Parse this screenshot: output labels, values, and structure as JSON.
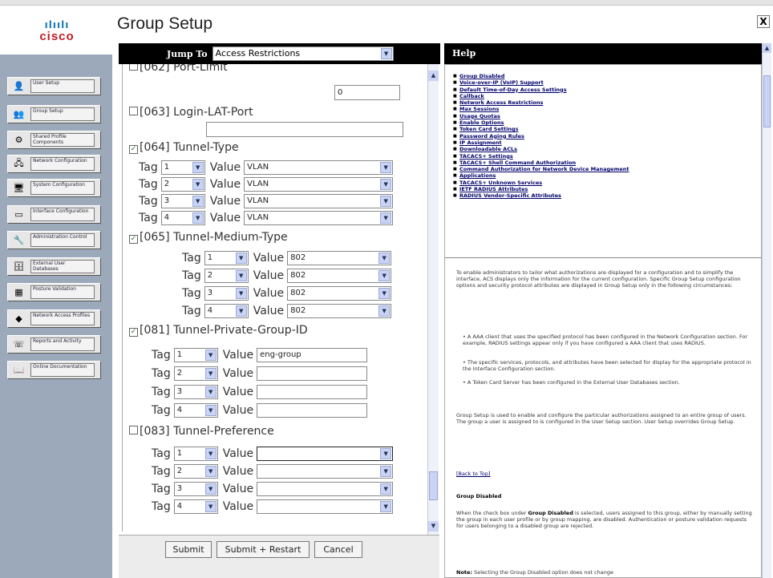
{
  "page": {
    "title": "Group Setup",
    "close": "X"
  },
  "logo": {
    "text": "cisco"
  },
  "nav": [
    {
      "label": "User Setup",
      "icon": "user-icon"
    },
    {
      "label": "Group Setup",
      "icon": "group-icon"
    },
    {
      "label": "Shared Profile Components",
      "icon": "shared-profile-icon"
    },
    {
      "label": "Network Configuration",
      "icon": "network-icon"
    },
    {
      "label": "System Configuration",
      "icon": "system-icon"
    },
    {
      "label": "Interface Configuration",
      "icon": "interface-icon"
    },
    {
      "label": "Administration Control",
      "icon": "admin-icon"
    },
    {
      "label": "External User Databases",
      "icon": "database-icon"
    },
    {
      "label": "Posture Validation",
      "icon": "posture-icon"
    },
    {
      "label": "Network Access Profiles",
      "icon": "network-access-icon"
    },
    {
      "label": "Reports and Activity",
      "icon": "reports-icon"
    },
    {
      "label": "Online Documentation",
      "icon": "documentation-icon"
    }
  ],
  "jump": {
    "label": "Jump To",
    "value": "Access Restrictions"
  },
  "form": {
    "port_limit": {
      "label": "[062] Port-Limit",
      "value": "0"
    },
    "login_lat": {
      "label": "[063] Login-LAT-Port",
      "value": ""
    },
    "tunnel_type": {
      "label": "[064] Tunnel-Type",
      "rows": [
        {
          "tag": "1",
          "value": "VLAN"
        },
        {
          "tag": "2",
          "value": "VLAN"
        },
        {
          "tag": "3",
          "value": "VLAN"
        },
        {
          "tag": "4",
          "value": "VLAN"
        }
      ]
    },
    "tunnel_medium": {
      "label": "[065] Tunnel-Medium-Type",
      "rows": [
        {
          "tag": "1",
          "value": "802"
        },
        {
          "tag": "2",
          "value": "802"
        },
        {
          "tag": "3",
          "value": "802"
        },
        {
          "tag": "4",
          "value": "802"
        }
      ]
    },
    "tunnel_private": {
      "label": "[081] Tunnel-Private-Group-ID",
      "rows": [
        {
          "tag": "1",
          "value": "eng-group"
        },
        {
          "tag": "2",
          "value": ""
        },
        {
          "tag": "3",
          "value": ""
        },
        {
          "tag": "4",
          "value": ""
        }
      ]
    },
    "tunnel_pref": {
      "label": "[083] Tunnel-Preference",
      "rows": [
        {
          "tag": "1",
          "value": ""
        },
        {
          "tag": "2",
          "value": ""
        },
        {
          "tag": "3",
          "value": ""
        },
        {
          "tag": "4",
          "value": ""
        }
      ]
    },
    "tag_label": "Tag",
    "value_label": "Value"
  },
  "buttons": {
    "submit": "Submit",
    "submit_restart": "Submit + Restart",
    "cancel": "Cancel"
  },
  "help": {
    "title": "Help",
    "links": [
      "Group Disabled",
      "Voice-over-IP (VoIP) Support",
      "Default Time-of-Day Access Settings",
      "Callback",
      "Network Access Restrictions",
      "Max Sessions",
      "Usage Quotas",
      "Enable Options",
      "Token Card Settings",
      "Password Aging Rules",
      "IP Assignment",
      "Downloadable ACLs",
      "TACACS+ Settings",
      "TACACS+ Shell Command Authorization",
      "Command Authorization for Network Device Management",
      "Applications",
      "TACACS+ Unknown Services",
      "IETF RADIUS Attributes",
      "RADIUS Vendor-Specific Attributes"
    ],
    "intro": "To enable administrators to tailor what authorizations are displayed for a configuration and to simplify the interface, ACS displays only the information for the current configuration. Specific Group Setup configuration options and security protocol attributes are displayed in Group Setup only in the following circumstances:",
    "bullets": [
      "A AAA client that uses the specified protocol has been configured in the Network Configuration section. For example, RADIUS settings appear only if you have configured a AAA client that uses RADIUS.",
      "The specific services, protocols, and attributes have been selected for display for the appropriate protocol in the Interface Configuration section.",
      "A Token Card Server has been configured in the External User Databases section."
    ],
    "para2": "Group Setup is used to enable and configure the particular authorizations assigned to an entire group of users. The group a user is assigned to is configured in the User Setup section. User Setup overrides Group Setup.",
    "back_to_top": "[Back to Top]",
    "section_title": "Group Disabled",
    "section_pre": "When the check box under ",
    "section_bold": "Group Disabled",
    "section_post": " is selected, users assigned to this group, either by manually setting the group in each user profile or by group mapping, are disabled. Authentication or posture validation requests for users belonging to a disabled group are rejected.",
    "note_label": "Note:",
    "note_text": " Selecting the Group Disabled option does not change"
  }
}
